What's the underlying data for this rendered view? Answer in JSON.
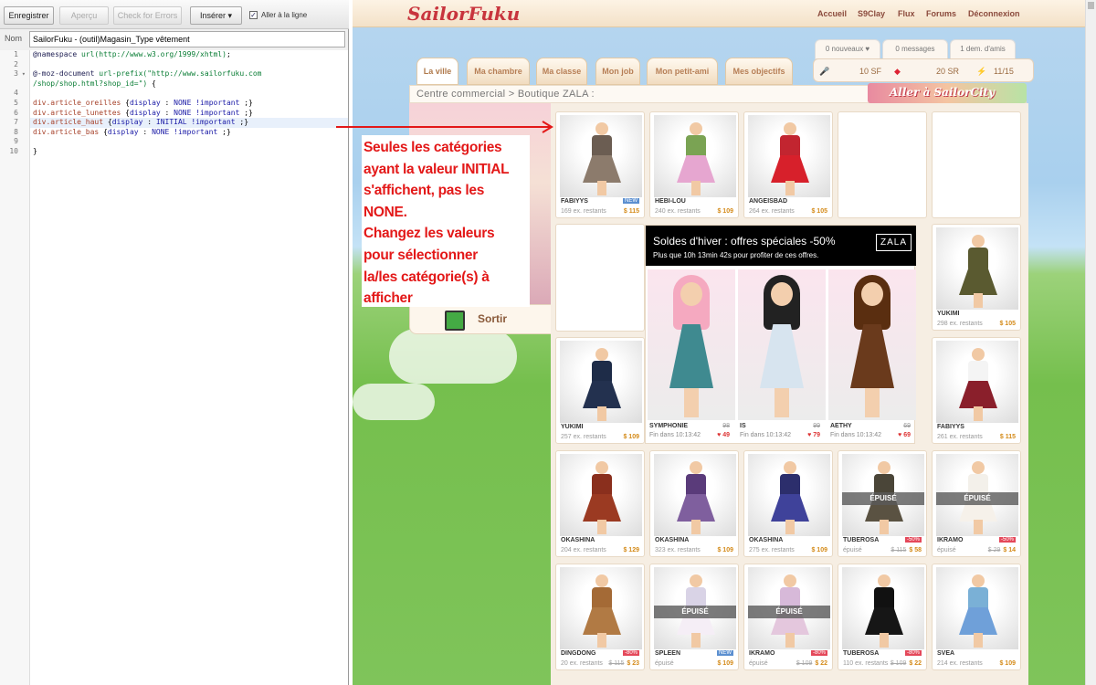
{
  "editor": {
    "buttons": {
      "save": "Enregistrer",
      "preview": "Aperçu",
      "check": "Check for Errors",
      "insert": "Insérer"
    },
    "goto_line_label": "Aller à la ligne",
    "name_label": "Nom",
    "name_value": "SailorFuku - (outil)Magasin_Type vêtement",
    "line_numbers": [
      "1",
      "2",
      "3",
      "4",
      "5",
      "6",
      "7",
      "8",
      "9",
      "10"
    ],
    "code": [
      {
        "parts": [
          [
            "c-at",
            "@namespace "
          ],
          [
            "c-url",
            "url(http://www.w3.org/1999/xhtml)"
          ],
          [
            "",
            "; "
          ]
        ]
      },
      {
        "parts": []
      },
      {
        "parts": [
          [
            "c-at",
            "@-moz-document "
          ],
          [
            "c-url",
            "url-prefix(\"http://www.sailorfuku.com"
          ]
        ]
      },
      {
        "parts": [
          [
            "c-url",
            "/shop/shop.html?shop_id=\")"
          ],
          [
            "",
            " {"
          ]
        ]
      },
      {
        "parts": []
      },
      {
        "parts": [
          [
            "c-sel",
            "div.article_oreilles "
          ],
          [
            "",
            "{"
          ],
          [
            "c-val",
            "display"
          ],
          [
            "",
            " : "
          ],
          [
            "c-val",
            "NONE !important"
          ],
          [
            "",
            " ;}"
          ]
        ]
      },
      {
        "parts": [
          [
            "c-sel",
            "div.article_lunettes "
          ],
          [
            "",
            "{"
          ],
          [
            "c-val",
            "display"
          ],
          [
            "",
            " : "
          ],
          [
            "c-val",
            "NONE !important"
          ],
          [
            "",
            " ;}"
          ]
        ]
      },
      {
        "parts": [
          [
            "c-sel",
            "div.article_haut "
          ],
          [
            "",
            "{"
          ],
          [
            "c-val",
            "display"
          ],
          [
            "",
            " : "
          ],
          [
            "c-val",
            "INITIAL !important"
          ],
          [
            "",
            " ;}"
          ]
        ],
        "hl": true
      },
      {
        "parts": [
          [
            "c-sel",
            "div.article_bas "
          ],
          [
            "",
            "{"
          ],
          [
            "c-val",
            "display"
          ],
          [
            "",
            " : "
          ],
          [
            "c-val",
            "NONE !important"
          ],
          [
            "",
            " ;}"
          ]
        ]
      },
      {
        "parts": []
      },
      {
        "parts": [
          [
            "",
            "}"
          ]
        ]
      }
    ]
  },
  "site": {
    "logo": "SailorFuku",
    "nav": [
      "Accueil",
      "S9Clay",
      "Flux",
      "Forums",
      "Déconnexion"
    ],
    "subtabs": [
      "0 nouveaux ♥",
      "0 messages",
      "1 dem. d'amis"
    ],
    "tabs": [
      "La ville",
      "Ma chambre",
      "Ma classe",
      "Mon job",
      "Mon petit-ami",
      "Mes objectifs"
    ],
    "stats": {
      "sf": "10 SF",
      "sr": "20 SR",
      "energy": "11/15"
    },
    "breadcrumb": "Centre commercial > Boutique ZALA :",
    "banner": "Aller à SailorCity",
    "exit": "Sortir"
  },
  "annotation": [
    "Seules les catégories",
    "ayant la valeur INITIAL",
    "s'affichent, pas les",
    "NONE.",
    "Changez les valeurs",
    "pour sélectionner",
    "la/les catégorie(s) à",
    "afficher"
  ],
  "promo": {
    "title": "Soldes d'hiver : offres spéciales -50%",
    "subtitle": "Plus que 10h 13min 42s pour profiter de ces offres.",
    "brand": "ZALA",
    "items": [
      {
        "name": "SYMPHONIE",
        "ends": "Fin dans 10:13:42",
        "old": "98",
        "new": "49"
      },
      {
        "name": "IS",
        "ends": "Fin dans 10:13:42",
        "old": "99",
        "new": "79"
      },
      {
        "name": "AETHY",
        "ends": "Fin dans 10:13:42",
        "old": "69",
        "new": "69"
      }
    ]
  },
  "products": [
    {
      "name": "FABIYYS",
      "stock": "169 ex. restants",
      "price": "$ 115",
      "badge": "NEW",
      "c1": "#6b5d52",
      "c2": "#8c7b6c"
    },
    {
      "name": "HEBI-LOU",
      "stock": "240 ex. restants",
      "price": "$ 109",
      "c1": "#7aa353",
      "c2": "#e6a6d0"
    },
    {
      "name": "ANGEISBAD",
      "stock": "264 ex. restants",
      "price": "$ 105",
      "c1": "#c22530",
      "c2": "#d7202b"
    },
    {
      "name": "YUKIMI",
      "stock": "298 ex. restants",
      "price": "$ 105",
      "c1": "#5a5a30",
      "c2": "#5a5a30"
    },
    {
      "name": "YUKIMI",
      "stock": "257 ex. restants",
      "price": "$ 109",
      "c1": "#1e2c48",
      "c2": "#23314f"
    },
    {
      "name": "FABIYYS",
      "stock": "261 ex. restants",
      "price": "$ 115",
      "c1": "#f4f4f4",
      "c2": "#8a1f2b"
    },
    {
      "name": "OKASHINA",
      "stock": "204 ex. restants",
      "price": "$ 129",
      "c1": "#8a2f1d",
      "c2": "#9b3a22"
    },
    {
      "name": "OKASHINA",
      "stock": "323 ex. restants",
      "price": "$ 109",
      "c1": "#5a3b7a",
      "c2": "#7f5f9e"
    },
    {
      "name": "OKASHINA",
      "stock": "275 ex. restants",
      "price": "$ 109",
      "c1": "#2c2e6c",
      "c2": "#3f429a"
    },
    {
      "name": "TUBEROSA",
      "stock": "épuisé",
      "price": "$ 58",
      "old": "$ 115",
      "off": "-50%",
      "sold": "ÉPUISÉ",
      "c1": "#4a4538",
      "c2": "#5a5242"
    },
    {
      "name": "IKRAMO",
      "stock": "épuisé",
      "price": "$ 14",
      "old": "$ 29",
      "off": "-50%",
      "sold": "ÉPUISÉ",
      "c1": "#f3f0ea",
      "c2": "#f6f1ea"
    },
    {
      "name": "DINGDONG",
      "stock": "20 ex. restants",
      "price": "$ 23",
      "old": "$ 115",
      "off": "-80%",
      "c1": "#a46a36",
      "c2": "#b17a44"
    },
    {
      "name": "SPLEEN",
      "stock": "épuisé",
      "price": "$ 109",
      "badge": "NEW",
      "sold": "ÉPUISÉ",
      "c1": "#d9d3e6",
      "c2": "#f5eef6"
    },
    {
      "name": "IKRAMO",
      "stock": "épuisé",
      "price": "$ 22",
      "old": "$ 109",
      "off": "-80%",
      "sold": "ÉPUISÉ",
      "c1": "#d7b9d9",
      "c2": "#e4c7dd"
    },
    {
      "name": "TUBEROSA",
      "stock": "110 ex. restants",
      "price": "$ 22",
      "old": "$ 109",
      "off": "-80%",
      "c1": "#111",
      "c2": "#161616"
    },
    {
      "name": "SVEA",
      "stock": "214 ex. restants",
      "price": "$ 109",
      "c1": "#7ab0d6",
      "c2": "#6fa0d9"
    }
  ]
}
